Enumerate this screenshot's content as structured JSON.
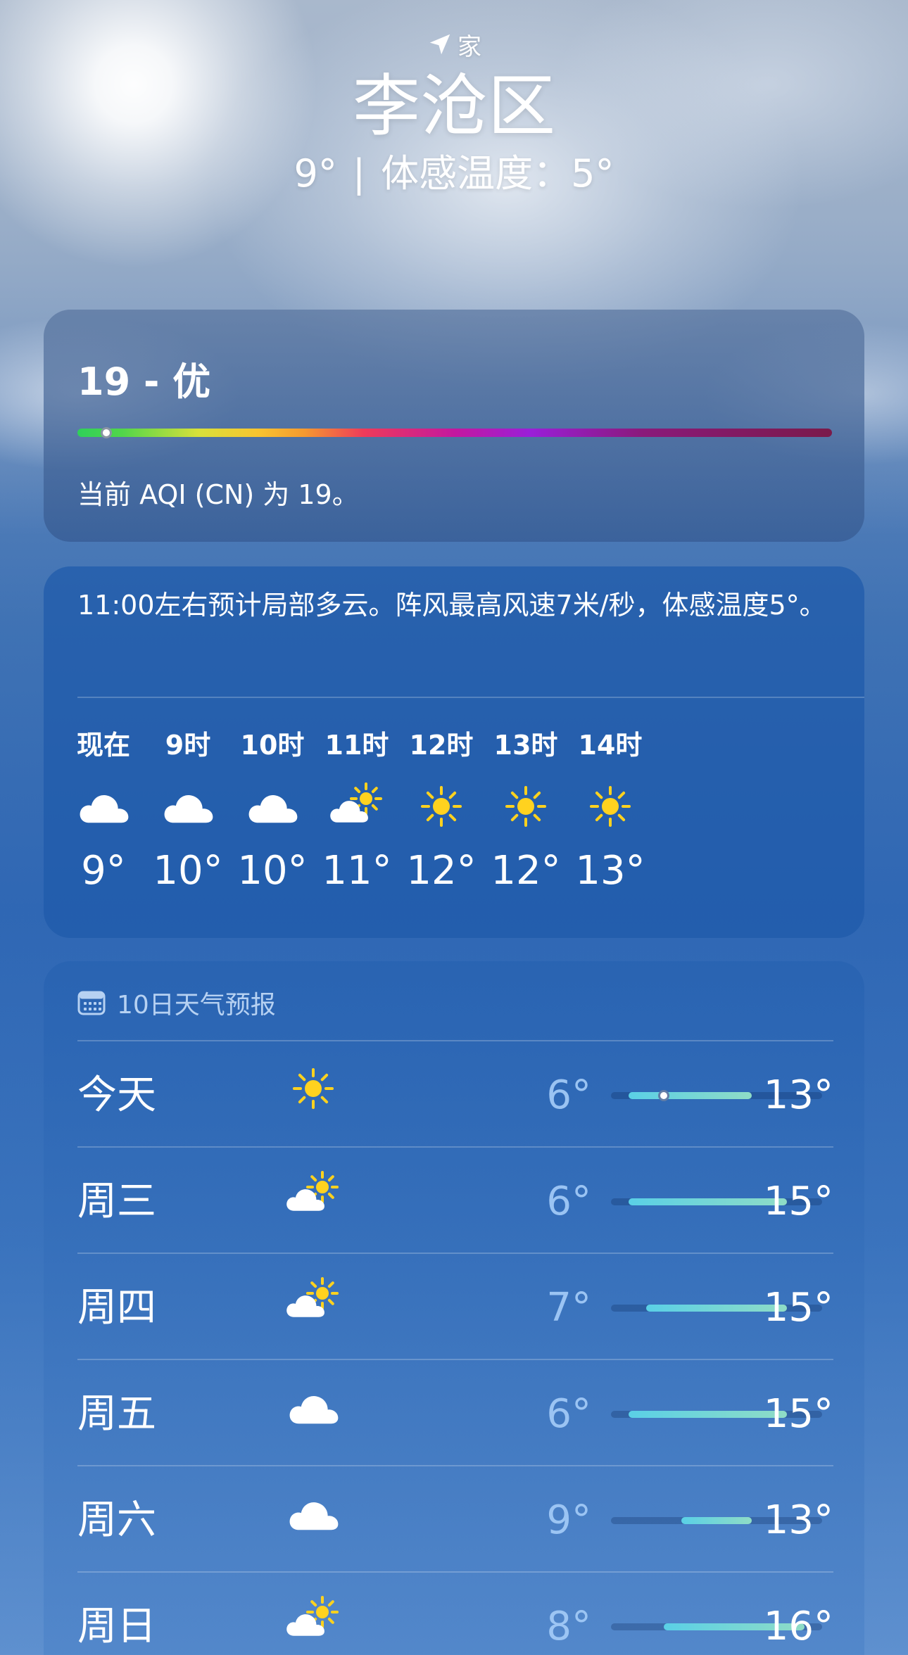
{
  "header": {
    "location_label": "家",
    "city": "李沧区",
    "current_temp": "9°",
    "separator": "|",
    "feels_like": "体感温度：5°"
  },
  "aqi": {
    "title": "19 - 优",
    "value": 19,
    "scale_max": 500,
    "description": "当前 AQI (CN) 为 19。"
  },
  "hourly": {
    "summary": "11:00左右预计局部多云。阵风最高风速7米/秒，体感温度5°。",
    "hours": [
      {
        "label": "现在",
        "icon": "cloud-icon",
        "temp": "9°"
      },
      {
        "label": "9时",
        "icon": "cloud-icon",
        "temp": "10°"
      },
      {
        "label": "10时",
        "icon": "cloud-icon",
        "temp": "10°"
      },
      {
        "label": "11时",
        "icon": "partly-sunny-icon",
        "temp": "11°"
      },
      {
        "label": "12时",
        "icon": "sun-icon",
        "temp": "12°"
      },
      {
        "label": "13时",
        "icon": "sun-icon",
        "temp": "12°"
      },
      {
        "label": "14时",
        "icon": "sun-icon",
        "temp": "13°"
      }
    ]
  },
  "daily": {
    "title": "10日天气预报",
    "range_min": 5,
    "range_max": 17,
    "days": [
      {
        "name": "今天",
        "icon": "sun-icon",
        "low": "6°",
        "high": "13°",
        "low_value": 6,
        "high_value": 13,
        "current_value": 8
      },
      {
        "name": "周三",
        "icon": "partly-sunny-icon",
        "low": "6°",
        "high": "15°",
        "low_value": 6,
        "high_value": 15
      },
      {
        "name": "周四",
        "icon": "partly-sunny-icon",
        "low": "7°",
        "high": "15°",
        "low_value": 7,
        "high_value": 15
      },
      {
        "name": "周五",
        "icon": "cloud-icon",
        "low": "6°",
        "high": "15°",
        "low_value": 6,
        "high_value": 15
      },
      {
        "name": "周六",
        "icon": "cloud-icon",
        "low": "9°",
        "high": "13°",
        "low_value": 9,
        "high_value": 13
      },
      {
        "name": "周日",
        "icon": "partly-sunny-icon",
        "low": "8°",
        "high": "16°",
        "low_value": 8,
        "high_value": 16
      }
    ]
  },
  "colors": {
    "sun": "#FFD21F",
    "cloud": "#FFFFFF",
    "low_temp": "#A0C8F5",
    "range_fill_start": "#5AD0E6",
    "range_fill_end": "#8FDCC6"
  }
}
